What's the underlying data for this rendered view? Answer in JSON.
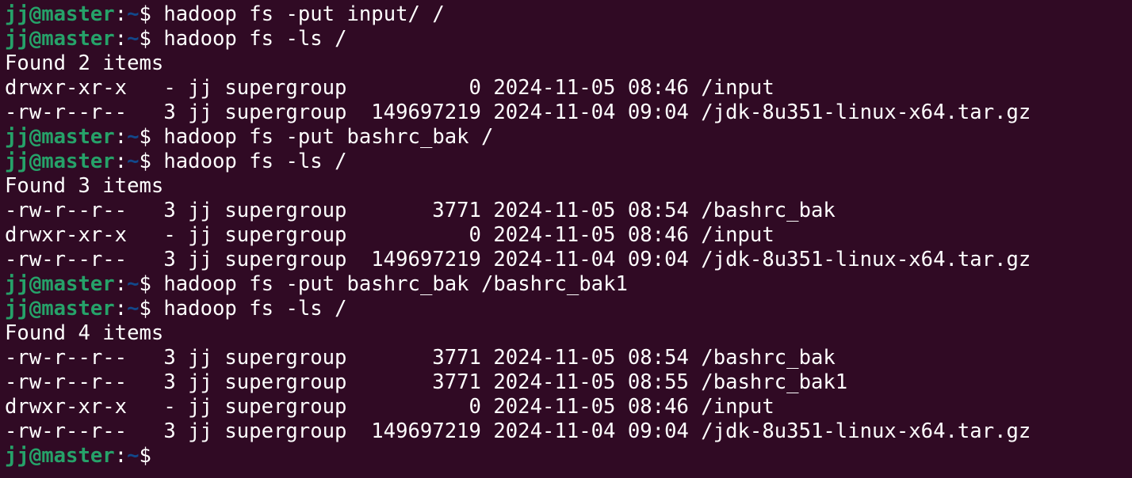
{
  "prompt": {
    "user_host": "jj@master",
    "separator": ":",
    "cwd": "~",
    "symbol": "$ "
  },
  "colors": {
    "background": "#300a24",
    "user_host": "#26a269",
    "cwd": "#12488b",
    "text": "#ffffff"
  },
  "lines": [
    {
      "type": "prompt",
      "command": "hadoop fs -put input/ /"
    },
    {
      "type": "prompt",
      "command": "hadoop fs -ls /"
    },
    {
      "type": "output",
      "text": "Found 2 items"
    },
    {
      "type": "output",
      "text": "drwxr-xr-x   - jj supergroup          0 2024-11-05 08:46 /input"
    },
    {
      "type": "output",
      "text": "-rw-r--r--   3 jj supergroup  149697219 2024-11-04 09:04 /jdk-8u351-linux-x64.tar.gz"
    },
    {
      "type": "prompt",
      "command": "hadoop fs -put bashrc_bak /"
    },
    {
      "type": "prompt",
      "command": "hadoop fs -ls /"
    },
    {
      "type": "output",
      "text": "Found 3 items"
    },
    {
      "type": "output",
      "text": "-rw-r--r--   3 jj supergroup       3771 2024-11-05 08:54 /bashrc_bak"
    },
    {
      "type": "output",
      "text": "drwxr-xr-x   - jj supergroup          0 2024-11-05 08:46 /input"
    },
    {
      "type": "output",
      "text": "-rw-r--r--   3 jj supergroup  149697219 2024-11-04 09:04 /jdk-8u351-linux-x64.tar.gz"
    },
    {
      "type": "prompt",
      "command": "hadoop fs -put bashrc_bak /bashrc_bak1"
    },
    {
      "type": "prompt",
      "command": "hadoop fs -ls /"
    },
    {
      "type": "output",
      "text": "Found 4 items"
    },
    {
      "type": "output",
      "text": "-rw-r--r--   3 jj supergroup       3771 2024-11-05 08:54 /bashrc_bak"
    },
    {
      "type": "output",
      "text": "-rw-r--r--   3 jj supergroup       3771 2024-11-05 08:55 /bashrc_bak1"
    },
    {
      "type": "output",
      "text": "drwxr-xr-x   - jj supergroup          0 2024-11-05 08:46 /input"
    },
    {
      "type": "output",
      "text": "-rw-r--r--   3 jj supergroup  149697219 2024-11-04 09:04 /jdk-8u351-linux-x64.tar.gz"
    },
    {
      "type": "prompt",
      "command": ""
    }
  ]
}
